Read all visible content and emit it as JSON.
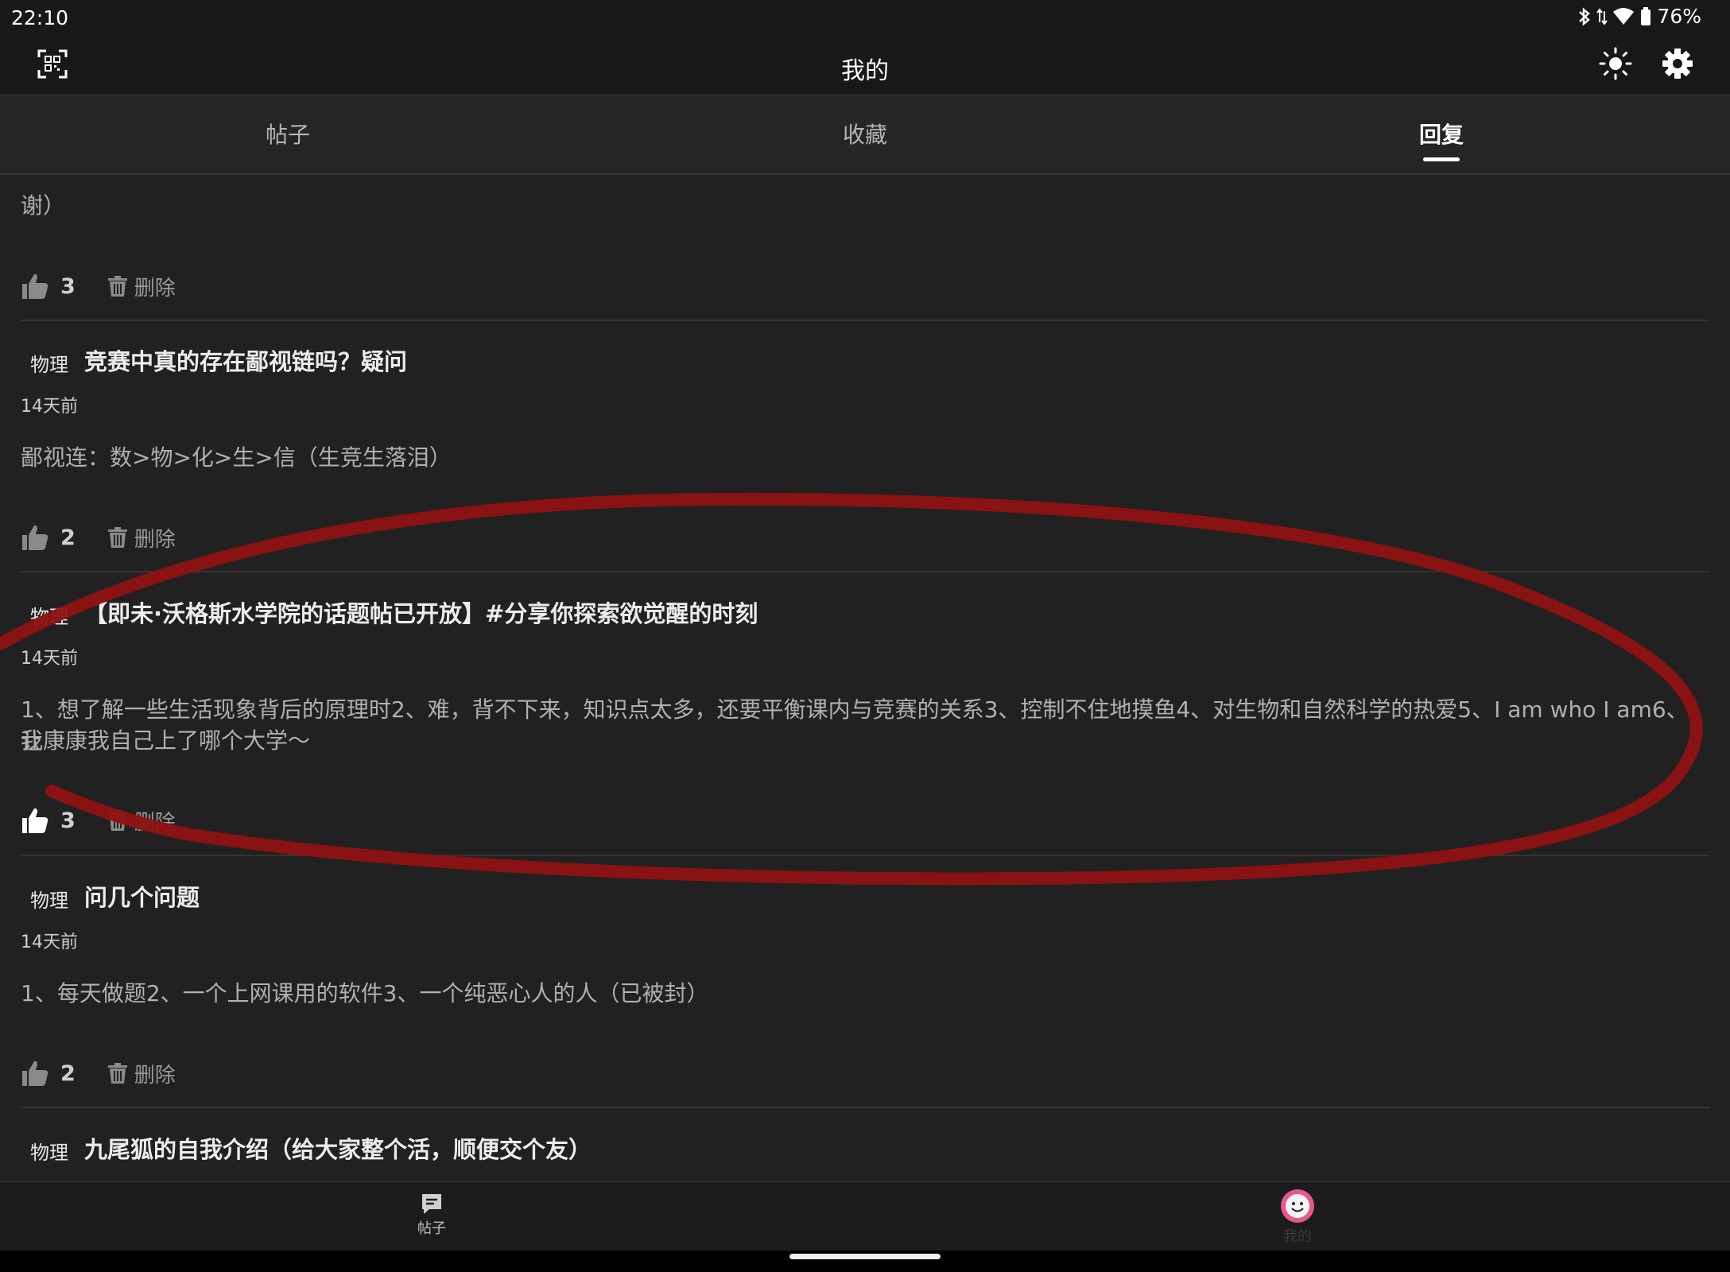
{
  "status_bar": {
    "time": "22:10",
    "battery": "76%"
  },
  "app_bar": {
    "title": "我的"
  },
  "tabs": [
    {
      "label": "帖子",
      "active": false
    },
    {
      "label": "收藏",
      "active": false
    },
    {
      "label": "回复",
      "active": true
    }
  ],
  "replies": [
    {
      "content": "谢）",
      "likes": "3",
      "delete_label": "删除"
    },
    {
      "tag": "物理",
      "title": "竞赛中真的存在鄙视链吗？疑问",
      "time": "14天前",
      "content": "鄙视连：数>物>化>生>信（生竞生落泪）",
      "likes": "2",
      "delete_label": "删除"
    },
    {
      "tag": "物理",
      "title": "【即未·沃格斯水学院的话题帖已开放】#分享你探索欲觉醒的时刻",
      "time": "14天前",
      "content_line1": "1、想了解一些生活现象背后的原理时2、难，背不下来，知识点太多，还要平衡课内与竞赛的关系3、控制不住地摸鱼4、对生物和自然科学的热爱5、I  am who I am6、让",
      "content_line2": "我康康我自己上了哪个大学～",
      "likes": "3",
      "delete_label": "删除"
    },
    {
      "tag": "物理",
      "title": "问几个问题",
      "time": "14天前",
      "content": "1、每天做题2、一个上网课用的软件3、一个纯恶心人的人（已被封）",
      "likes": "2",
      "delete_label": "删除"
    },
    {
      "tag": "物理",
      "title": "九尾狐的自我介绍（给大家整个活，顺便交个友）"
    }
  ],
  "bottom_nav": [
    {
      "label": "帖子",
      "icon": "post-icon"
    },
    {
      "label": "我的",
      "icon": "smiley-avatar-icon"
    }
  ],
  "colors": {
    "annotation": "#8f1212",
    "avatar": "#e8578f",
    "background": "#212121"
  }
}
